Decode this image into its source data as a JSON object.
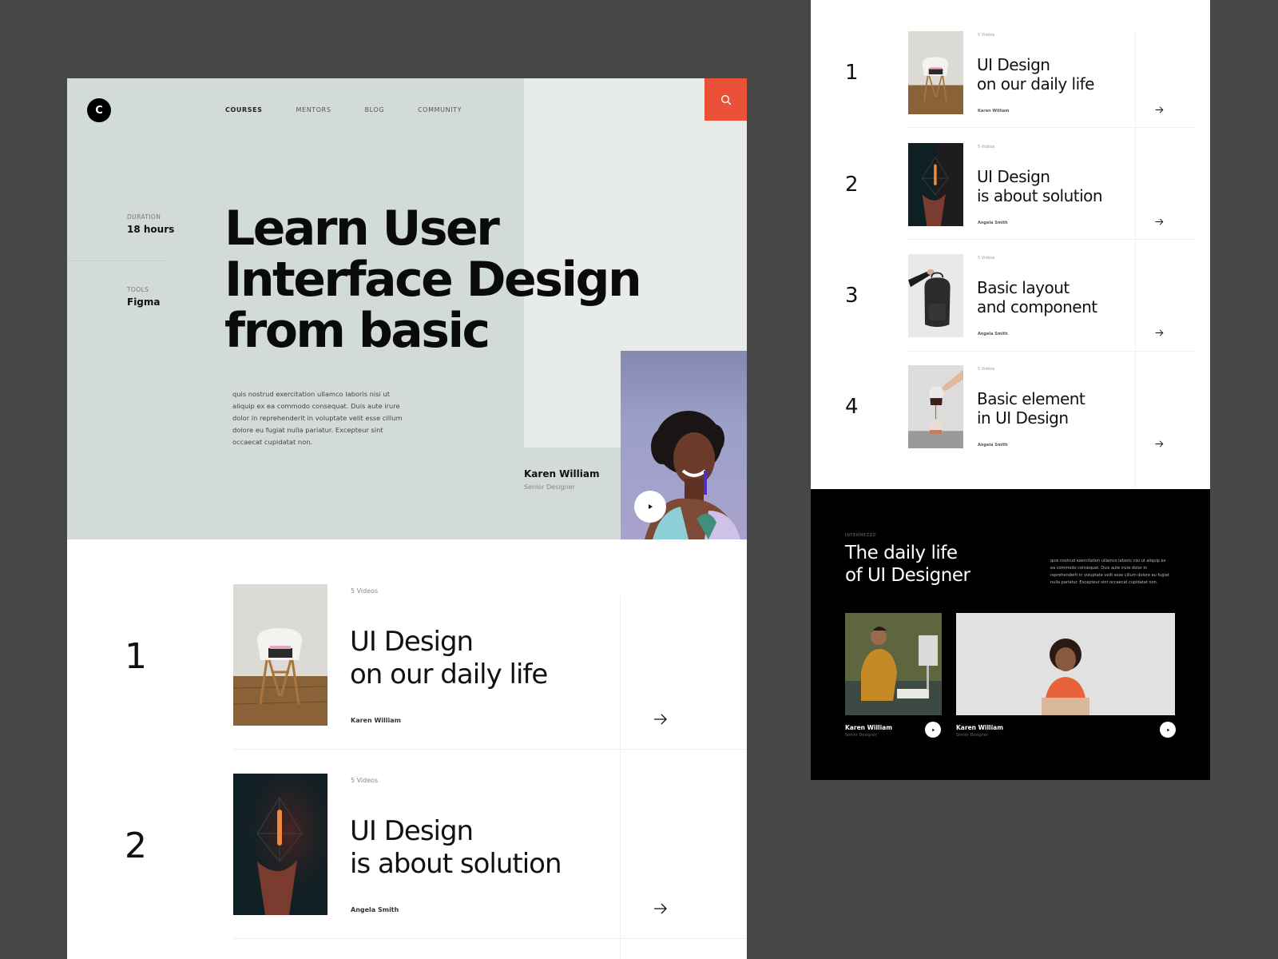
{
  "main": {
    "logo": {
      "letter": "C"
    },
    "nav": [
      {
        "label": "COURSES",
        "active": true
      },
      {
        "label": "MENTORS",
        "active": false
      },
      {
        "label": "BLOG",
        "active": false
      },
      {
        "label": "COMMUNITY",
        "active": false
      }
    ],
    "search_icon": "search-icon",
    "meta": [
      {
        "label": "DURATION",
        "value": "18 hours"
      },
      {
        "label": "TOOLS",
        "value": "Figma"
      }
    ],
    "hero_title": "Learn User\nInterface Design\nfrom basic",
    "hero_description": "quis nostrud exercitation ullamco laboris nisi ut aliquip ex ea commodo consequat. Duis aute irure dolor in reprehenderit in voluptate velit esse cillum dolore eu fugiat nulla pariatur. Excepteur sint occaecat cupidatat non.",
    "instructor": {
      "name": "Karen William",
      "role": "Senior Designer"
    },
    "courses": [
      {
        "number": "1",
        "videos": "5 Videos",
        "title": "UI Design\non our daily life",
        "author": "Karen William",
        "thumb": "chair"
      },
      {
        "number": "2",
        "videos": "5 Videos",
        "title": "UI Design\nis about solution",
        "author": "Angela Smith",
        "thumb": "lamp"
      }
    ]
  },
  "list": {
    "courses": [
      {
        "number": "1",
        "videos": "5 Videos",
        "title": "UI Design\non our daily life",
        "author": "Karen William",
        "thumb": "chair"
      },
      {
        "number": "2",
        "videos": "5 Videos",
        "title": "UI Design\nis about solution",
        "author": "Angela Smith",
        "thumb": "lamp"
      },
      {
        "number": "3",
        "videos": "5 Videos",
        "title": "Basic layout\nand component",
        "author": "Angela Smith",
        "thumb": "backpack"
      },
      {
        "number": "4",
        "videos": "5 Videos",
        "title": "Basic element\nin UI Design",
        "author": "Angela Smith",
        "thumb": "coffee"
      }
    ]
  },
  "intermezzo": {
    "kicker": "INTERMEZZO",
    "title": "The daily life\nof UI Designer",
    "description": "quis nostrud exercitation ullamco laboris nisi ut aliquip ex ea commodo consequat. Duis aute irure dolor in reprehenderit in voluptate velit esse cillum dolore eu fugiat nulla pariatur. Excepteur sint occaecat cupidatat non.",
    "videos": [
      {
        "name": "Karen William",
        "role": "Senior Designer"
      },
      {
        "name": "Karen William",
        "role": "Senior Designer"
      }
    ]
  },
  "colors": {
    "accent": "#eb5136",
    "hero_bg": "#d2dbda",
    "hero_panel": "#e7ebea",
    "backdrop": "#474747"
  }
}
